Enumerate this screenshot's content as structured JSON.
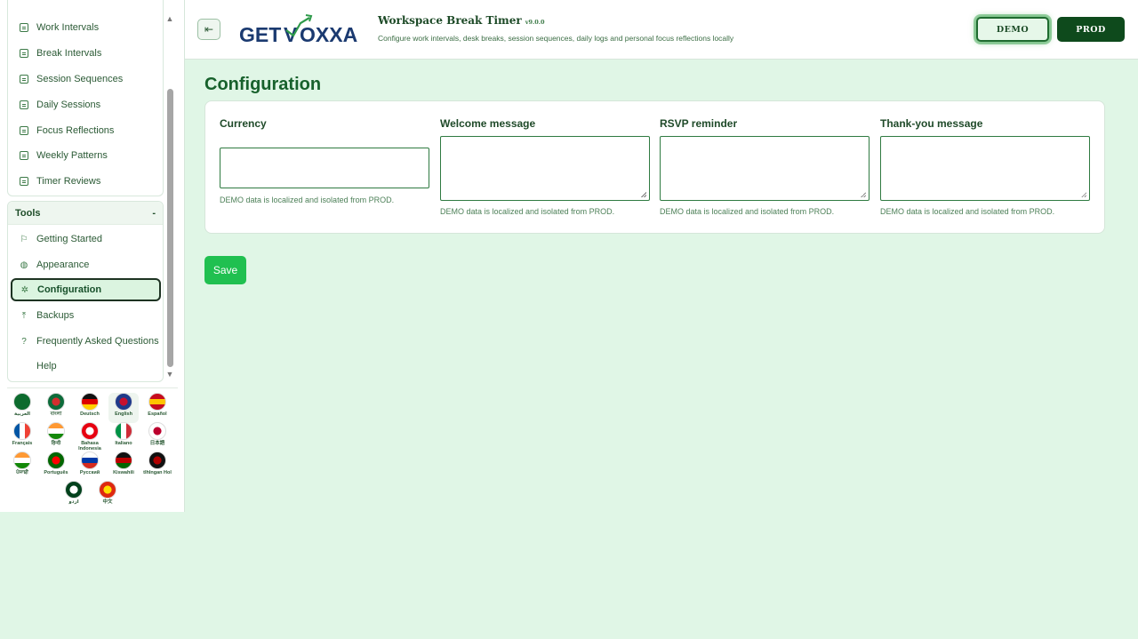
{
  "sidebar": {
    "items": [
      {
        "label": "Work Intervals"
      },
      {
        "label": "Break Intervals"
      },
      {
        "label": "Session Sequences"
      },
      {
        "label": "Daily Sessions"
      },
      {
        "label": "Focus Reflections"
      },
      {
        "label": "Weekly Patterns"
      },
      {
        "label": "Timer Reviews"
      }
    ],
    "tools_title": "Tools",
    "tools_toggle": "-",
    "tools": [
      {
        "label": "Getting Started",
        "icon": "flag-icon"
      },
      {
        "label": "Appearance",
        "icon": "palette-icon"
      },
      {
        "label": "Configuration",
        "icon": "gear-icon",
        "active": true
      },
      {
        "label": "Backups",
        "icon": "upload-icon"
      },
      {
        "label": "Frequently Asked Questions",
        "icon": "help-circle-icon"
      },
      {
        "label": "Help",
        "icon": ""
      }
    ]
  },
  "languages": [
    {
      "label": "العربية",
      "colors": [
        "#0d6b2e",
        "#0d6b2e"
      ]
    },
    {
      "label": "বাংলা",
      "colors": [
        "#0d6b3a",
        "#d32f2f"
      ]
    },
    {
      "label": "Deutsch",
      "colors": [
        "#111111",
        "#dd0000",
        "#ffce00"
      ]
    },
    {
      "label": "English",
      "colors": [
        "#1f3a8a",
        "#c8102e"
      ]
    },
    {
      "label": "Español",
      "colors": [
        "#c60b1e",
        "#ffc400",
        "#c60b1e"
      ]
    },
    {
      "label": "Français",
      "colors": [
        "#0055a4",
        "#ffffff",
        "#ef4135"
      ]
    },
    {
      "label": "हिन्दी",
      "colors": [
        "#ff9933",
        "#ffffff",
        "#138808"
      ]
    },
    {
      "label": "Bahasa Indonesia",
      "colors": [
        "#e70011",
        "#ffffff"
      ]
    },
    {
      "label": "Italiano",
      "colors": [
        "#009246",
        "#ffffff",
        "#ce2b37"
      ]
    },
    {
      "label": "日本語",
      "colors": [
        "#ffffff",
        "#bc002d"
      ]
    },
    {
      "label": "ਪੰਜਾਬੀ",
      "colors": [
        "#ff9933",
        "#ffffff",
        "#138808"
      ]
    },
    {
      "label": "Português",
      "colors": [
        "#006600",
        "#ff0000"
      ]
    },
    {
      "label": "Русский",
      "colors": [
        "#ffffff",
        "#0039a6",
        "#d52b1e"
      ]
    },
    {
      "label": "Kiswahili",
      "colors": [
        "#111111",
        "#bb0000",
        "#006600"
      ]
    },
    {
      "label": "tlhIngan Hol",
      "colors": [
        "#111111",
        "#b00000"
      ]
    },
    {
      "label": "اردو",
      "colors": [
        "#01411c",
        "#ffffff"
      ]
    },
    {
      "label": "中文",
      "colors": [
        "#de2910",
        "#ffde00"
      ]
    }
  ],
  "header": {
    "logo_text": "GETVOXXA",
    "app_title": "Workspace Break Timer",
    "version": "v9.0.0",
    "subtitle": "Configure work intervals, desk breaks, session sequences, daily logs and personal focus reflections locally",
    "demo_label": "DEMO",
    "prod_label": "PROD"
  },
  "main": {
    "title": "Configuration",
    "fields": [
      {
        "label": "Currency",
        "value": "",
        "help": "DEMO data is localized and isolated from PROD."
      },
      {
        "label": "Welcome message",
        "value": "",
        "help": "DEMO data is localized and isolated from PROD."
      },
      {
        "label": "RSVP reminder",
        "value": "",
        "help": "DEMO data is localized and isolated from PROD."
      },
      {
        "label": "Thank-you message",
        "value": "",
        "help": "DEMO data is localized and isolated from PROD."
      }
    ],
    "save_label": "Save"
  },
  "colors": {
    "accent": "#17612c",
    "background": "#e0f6e6",
    "save": "#20c050",
    "prod": "#0e4a1c"
  }
}
